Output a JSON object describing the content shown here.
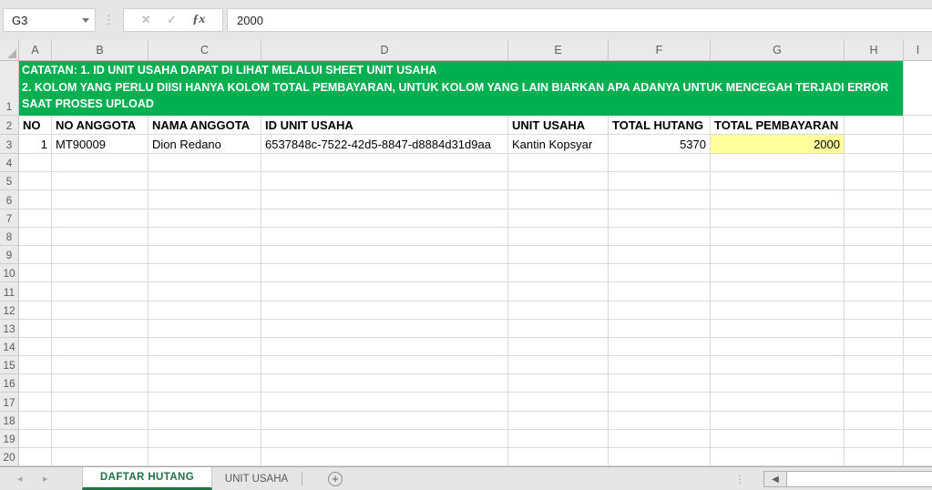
{
  "formula_bar": {
    "name_box_value": "G3",
    "cancel_icon": "✕",
    "enter_icon": "✓",
    "function_icon": "ƒx",
    "formula_value": "2000"
  },
  "worksheet": {
    "column_headers": [
      "A",
      "B",
      "C",
      "D",
      "E",
      "F",
      "G",
      "H",
      "I"
    ],
    "row_numbers": [
      "1",
      "2",
      "3",
      "4",
      "5",
      "6",
      "7",
      "8",
      "9",
      "10",
      "11",
      "12",
      "13",
      "14",
      "15",
      "16",
      "17",
      "18",
      "19",
      "20"
    ],
    "banner": {
      "lines": [
        "CATATAN: 1. ID UNIT USAHA DAPAT DI LIHAT MELALUI SHEET UNIT USAHA",
        "2. KOLOM YANG PERLU DIISI HANYA KOLOM TOTAL PEMBAYARAN, UNTUK KOLOM YANG LAIN BIARKAN APA ADANYA UNTUK MENCEGAH TERJADI ERROR",
        "SAAT PROSES UPLOAD"
      ],
      "bg_color": "#00B050",
      "text_color": "#FFFFFF"
    },
    "header_row": [
      "NO",
      "NO ANGGOTA",
      "NAMA ANGGOTA",
      "ID UNIT USAHA",
      "UNIT USAHA",
      "TOTAL HUTANG",
      "TOTAL PEMBAYARAN"
    ],
    "data_row": {
      "no": "1",
      "no_anggota": "MT90009",
      "nama_anggota": "Dion Redano",
      "id_unit_usaha": "6537848c-7522-42d5-8847-d8884d31d9aa",
      "unit_usaha": "Kantin Kopsyar",
      "total_hutang": "5370",
      "total_pembayaran": "2000"
    },
    "selected_cell": {
      "ref": "G3",
      "highlight_color": "#FFFF9E"
    }
  },
  "sheet_tabs": {
    "nav_prev_icon": "◂",
    "nav_next_icon": "▸",
    "active_tab": "DAFTAR HUTANG",
    "inactive_tab": "UNIT USAHA",
    "add_sheet_label": "+",
    "active_color": "#217346",
    "scroll_left_icon": "◀",
    "dots_icon": "⋮"
  }
}
